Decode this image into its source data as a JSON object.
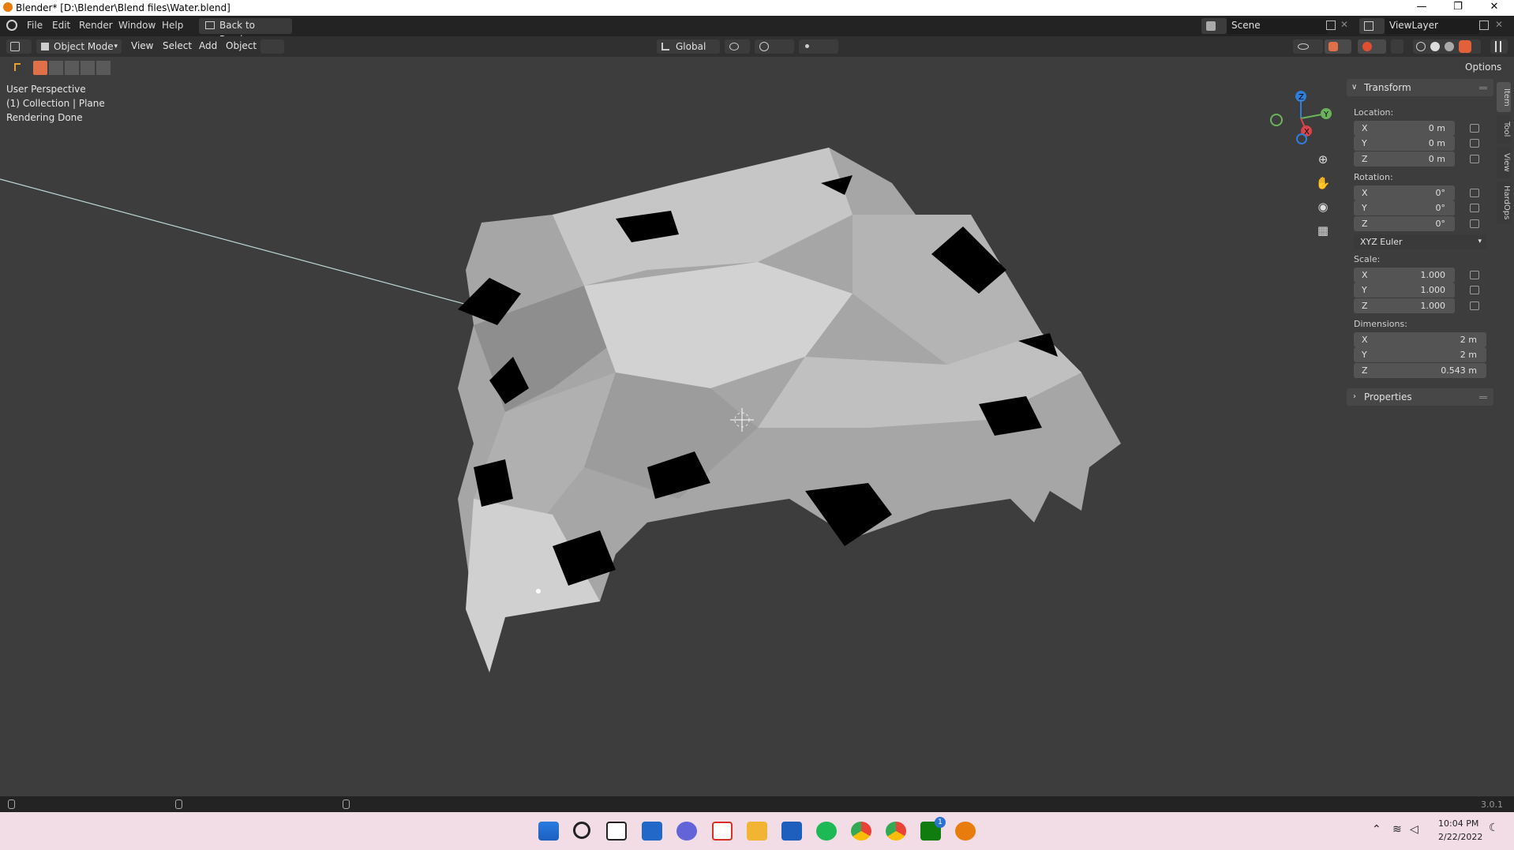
{
  "window": {
    "title": "Blender* [D:\\Blender\\Blend files\\Water.blend]",
    "minimize": "—",
    "restore": "❐",
    "close": "✕"
  },
  "menu": {
    "items": [
      "File",
      "Edit",
      "Render",
      "Window",
      "Help"
    ],
    "back_label": "Back to Previous",
    "scene_label": "Scene",
    "viewlayer_label": "ViewLayer"
  },
  "header": {
    "mode": "Object Mode",
    "menus": [
      "View",
      "Select",
      "Add",
      "Object"
    ],
    "orientation": "Global",
    "options": "Options"
  },
  "viewport": {
    "line1": "User Perspective",
    "line2": "(1) Collection | Plane",
    "line3": "Rendering Done"
  },
  "gizmo": {
    "z": "Z",
    "y": "Y",
    "x": "X"
  },
  "npanel": {
    "transform": "Transform",
    "location_label": "Location:",
    "location": [
      {
        "a": "X",
        "v": "0 m"
      },
      {
        "a": "Y",
        "v": "0 m"
      },
      {
        "a": "Z",
        "v": "0 m"
      }
    ],
    "rotation_label": "Rotation:",
    "rotation": [
      {
        "a": "X",
        "v": "0°"
      },
      {
        "a": "Y",
        "v": "0°"
      },
      {
        "a": "Z",
        "v": "0°"
      }
    ],
    "rotation_mode": "XYZ Euler",
    "scale_label": "Scale:",
    "scale": [
      {
        "a": "X",
        "v": "1.000"
      },
      {
        "a": "Y",
        "v": "1.000"
      },
      {
        "a": "Z",
        "v": "1.000"
      }
    ],
    "dimensions_label": "Dimensions:",
    "dimensions": [
      {
        "a": "X",
        "v": "2 m"
      },
      {
        "a": "Y",
        "v": "2 m"
      },
      {
        "a": "Z",
        "v": "0.543 m"
      }
    ],
    "properties": "Properties"
  },
  "tabs": [
    "Item",
    "Tool",
    "View",
    "HardOps"
  ],
  "status": {
    "version": "3.0.1"
  },
  "taskbar": {
    "time": "10:04 PM",
    "date": "2/22/2022",
    "badge": "1"
  }
}
